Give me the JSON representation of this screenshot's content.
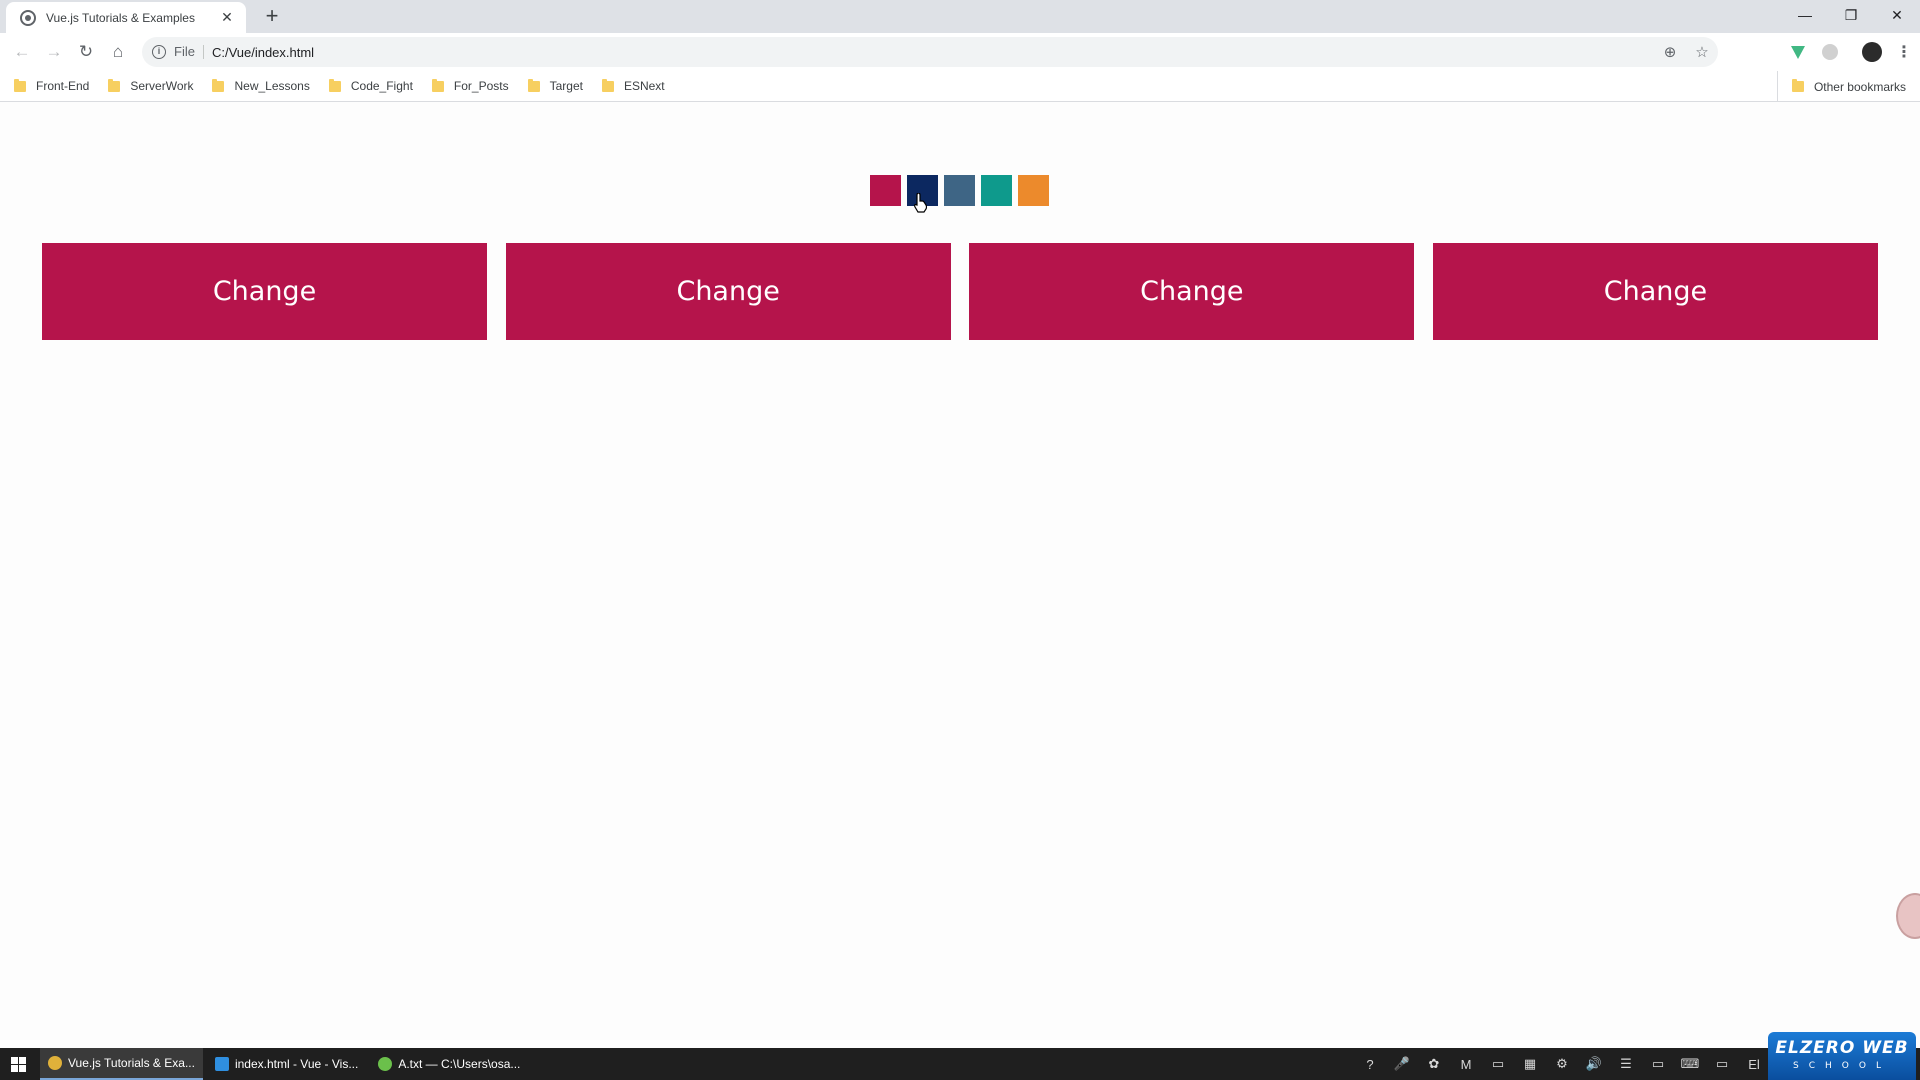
{
  "browser": {
    "tab_title": "Vue.js Tutorials & Examples",
    "tab_close": "✕",
    "new_tab": "+",
    "win_minimize": "—",
    "win_restore": "❐",
    "win_close": "✕",
    "back": "←",
    "forward": "→",
    "reload": "↻",
    "home": "⌂",
    "scheme": "File",
    "url": "C:/Vue/index.html",
    "zoom_icon": "⊕",
    "star_icon": "☆",
    "menu_icon": "⋮"
  },
  "bookmarks": {
    "items": [
      "Front-End",
      "ServerWork",
      "New_Lessons",
      "Code_Fight",
      "For_Posts",
      "Target",
      "ESNext"
    ],
    "other": "Other bookmarks"
  },
  "page": {
    "swatch_colors": [
      "#b5144b",
      "#0c2860",
      "#3e6585",
      "#0e9a8c",
      "#ec8a2c"
    ],
    "selected_swatch_index": 1,
    "button_color": "#b5144b",
    "buttons": [
      "Change",
      "Change",
      "Change",
      "Change"
    ]
  },
  "taskbar": {
    "tasks": [
      {
        "label": "Vue.js Tutorials & Exa...",
        "icon_color": "#e0b13a",
        "active": true
      },
      {
        "label": "index.html - Vue - Vis...",
        "icon_color": "#2f8fe0",
        "active": false
      },
      {
        "label": "A.txt — C:\\Users\\osa...",
        "icon_color": "#6bc04b",
        "active": false
      }
    ],
    "tray_icons": [
      "?",
      "🎤",
      "✿",
      "M",
      "▭",
      "▦",
      "⚙",
      "🔊",
      "☰",
      "▭",
      "⌨",
      "▭",
      "El"
    ]
  },
  "watermark": {
    "main": "ELZERO WEB",
    "sub": "SCHOOL"
  }
}
